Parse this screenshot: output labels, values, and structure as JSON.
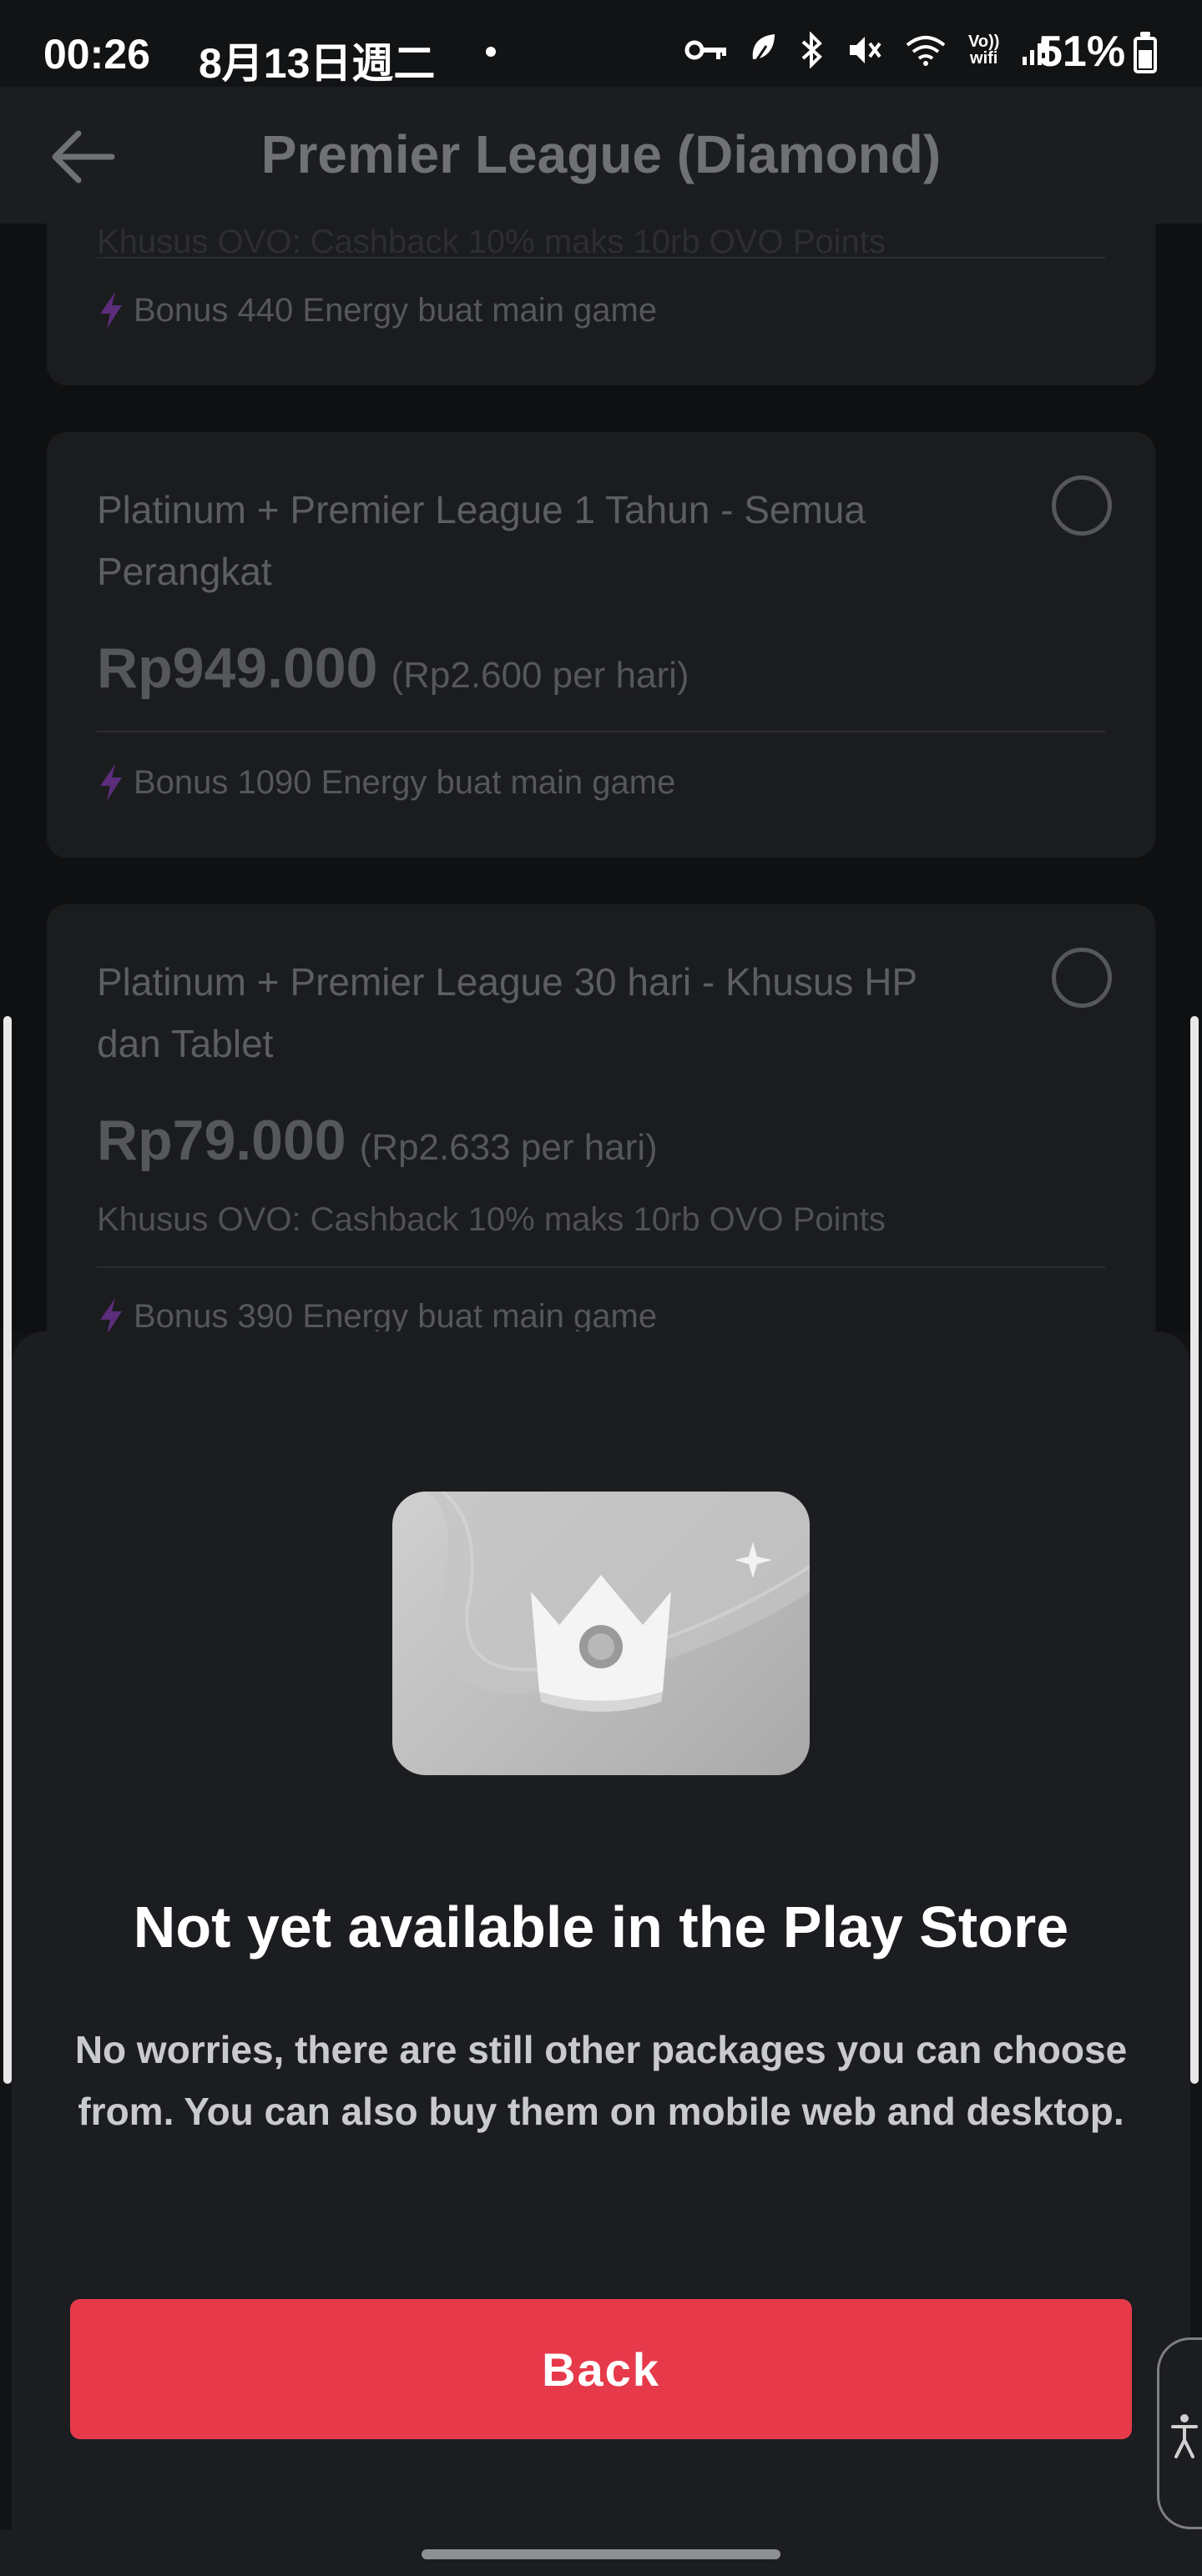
{
  "status_bar": {
    "time": "00:26",
    "date": "8月13日週二",
    "battery": "51%",
    "icons": [
      "key-icon",
      "leaf-icon",
      "bluetooth-icon",
      "mute-icon",
      "wifi-icon",
      "vowifi-icon",
      "signal-icon",
      "battery-icon"
    ],
    "vowifi_top": "Vo))",
    "vowifi_bottom": "wifi"
  },
  "header": {
    "back_icon": "arrow-left-icon",
    "title": "Premier League (Diamond)"
  },
  "packages": [
    {
      "title": "",
      "promo": "Khusus OVO: Cashback 10% maks 10rb OVO Points",
      "bonus": "Bonus 440 Energy buat main game"
    },
    {
      "title": "Platinum + Premier League 1 Tahun - Semua Perangkat",
      "price": "Rp949.000",
      "per_day": "(Rp2.600 per hari)",
      "bonus": "Bonus 1090 Energy buat main game",
      "selected": false
    },
    {
      "title": "Platinum + Premier League 30 hari - Khusus HP dan Tablet",
      "price": "Rp79.000",
      "per_day": "(Rp2.633 per hari)",
      "promo": "Khusus OVO: Cashback 10% maks 10rb OVO Points",
      "bonus": "Bonus 390 Energy buat main game",
      "selected": false
    }
  ],
  "sheet": {
    "illustration": "crown-card-icon",
    "title": "Not yet available in the Play Store",
    "message": "No worries, there are still other packages you can choose from. You can also buy them on mobile web and desktop.",
    "button_label": "Back"
  },
  "colors": {
    "accent": "#e63a4b",
    "bolt": "#5b2d7a",
    "background": "#121314",
    "sheet": "#1c1d20"
  }
}
